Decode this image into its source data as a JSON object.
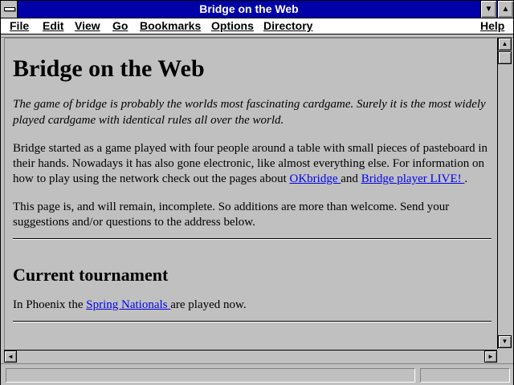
{
  "window": {
    "title": "Bridge on the Web"
  },
  "menubar": {
    "items": [
      {
        "label": "File"
      },
      {
        "label": "Edit"
      },
      {
        "label": "View"
      },
      {
        "label": "Go"
      },
      {
        "label": "Bookmarks"
      },
      {
        "label": "Options"
      },
      {
        "label": "Directory"
      },
      {
        "label": "Help"
      }
    ]
  },
  "page": {
    "heading": "Bridge on the Web",
    "intro": "The game of bridge is probably the worlds most fascinating cardgame. Surely it is the most widely played cardgame with identical rules all over the world.",
    "para1_before": "Bridge started as a game played with four people around a table with small pieces of pasteboard in their hands. Nowadays it has also gone electronic, like almost everything else. For information on how to play using the network check out the pages about ",
    "link_okbridge": "OKbridge ",
    "para1_and": "and ",
    "link_live": "Bridge player LIVE! ",
    "para1_end": ".",
    "para2": "This page is, and will remain, incomplete. So additions are more than welcome. Send your suggestions and/or questions to the address below.",
    "section_heading": "Current tournament",
    "para3_before": "In Phoenix the ",
    "link_spring": "Spring Nationals ",
    "para3_after": "are played now."
  },
  "status": {
    "text": ""
  },
  "icons": {
    "scroll_up": "▲",
    "scroll_down": "▼",
    "scroll_left": "◄",
    "scroll_right": "►",
    "minimize": "▼",
    "maximize": "▲"
  }
}
